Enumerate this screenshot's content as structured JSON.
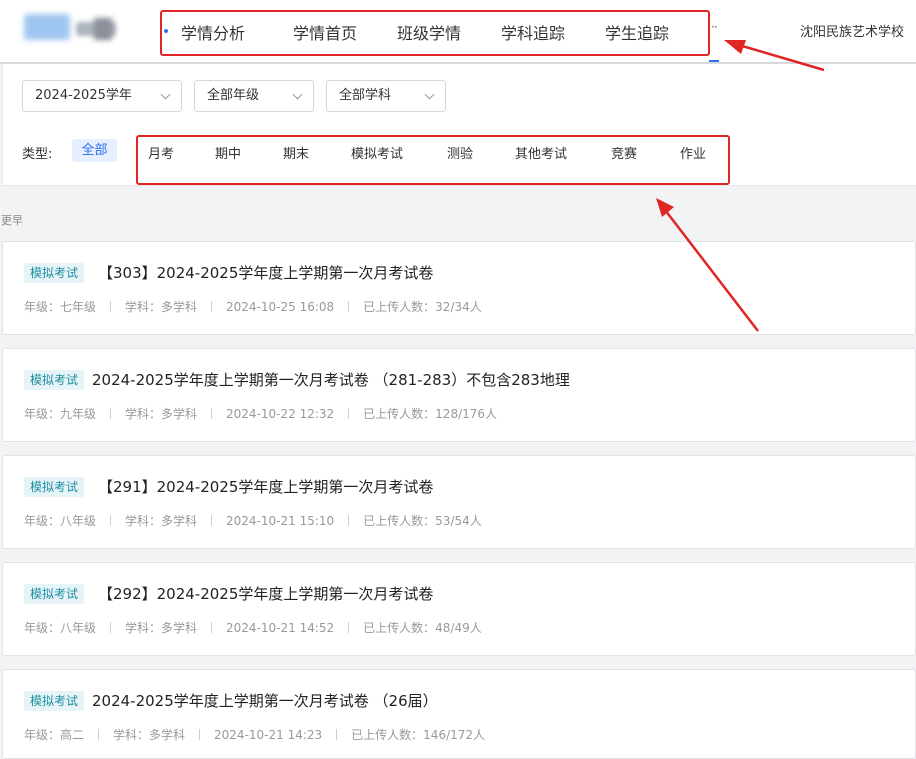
{
  "nav": {
    "items": [
      "学情分析",
      "学情首页",
      "班级学情",
      "学科追踪",
      "学生追踪"
    ],
    "more": "··",
    "school": "沈阳民族艺术学校"
  },
  "filters": {
    "year": "2024-2025学年",
    "grade": "全部年级",
    "subject": "全部学科"
  },
  "type_filter": {
    "label": "类型:",
    "selected": "全部",
    "options": [
      "月考",
      "期中",
      "期末",
      "模拟考试",
      "测验",
      "其他考试",
      "竞赛",
      "作业"
    ]
  },
  "section_label": "更早",
  "exams": [
    {
      "tag": "模拟考试",
      "title": "【303】2024-2025学年度上学期第一次月考试卷",
      "grade": "年级：七年级",
      "subject": "学科：多学科",
      "time": "2024-10-25 16:08",
      "uploaded": "已上传人数：32/34人"
    },
    {
      "tag": "模拟考试",
      "title": "2024-2025学年度上学期第一次月考试卷 （281-283）不包含283地理",
      "grade": "年级：九年级",
      "subject": "学科：多学科",
      "time": "2024-10-22 12:32",
      "uploaded": "已上传人数：128/176人"
    },
    {
      "tag": "模拟考试",
      "title": "【291】2024-2025学年度上学期第一次月考试卷",
      "grade": "年级：八年级",
      "subject": "学科：多学科",
      "time": "2024-10-21 15:10",
      "uploaded": "已上传人数：53/54人"
    },
    {
      "tag": "模拟考试",
      "title": "【292】2024-2025学年度上学期第一次月考试卷",
      "grade": "年级：八年级",
      "subject": "学科：多学科",
      "time": "2024-10-21 14:52",
      "uploaded": "已上传人数：48/49人"
    },
    {
      "tag": "模拟考试",
      "title": "2024-2025学年度上学期第一次月考试卷 （26届）",
      "grade": "年级：高二",
      "subject": "学科：多学科",
      "time": "2024-10-21 14:23",
      "uploaded": "已上传人数：146/172人"
    }
  ],
  "colors": {
    "accent": "#2f6fea",
    "annotation": "#e02525",
    "tag_bg": "#e6f4f7",
    "tag_text": "#1d8ea3"
  }
}
